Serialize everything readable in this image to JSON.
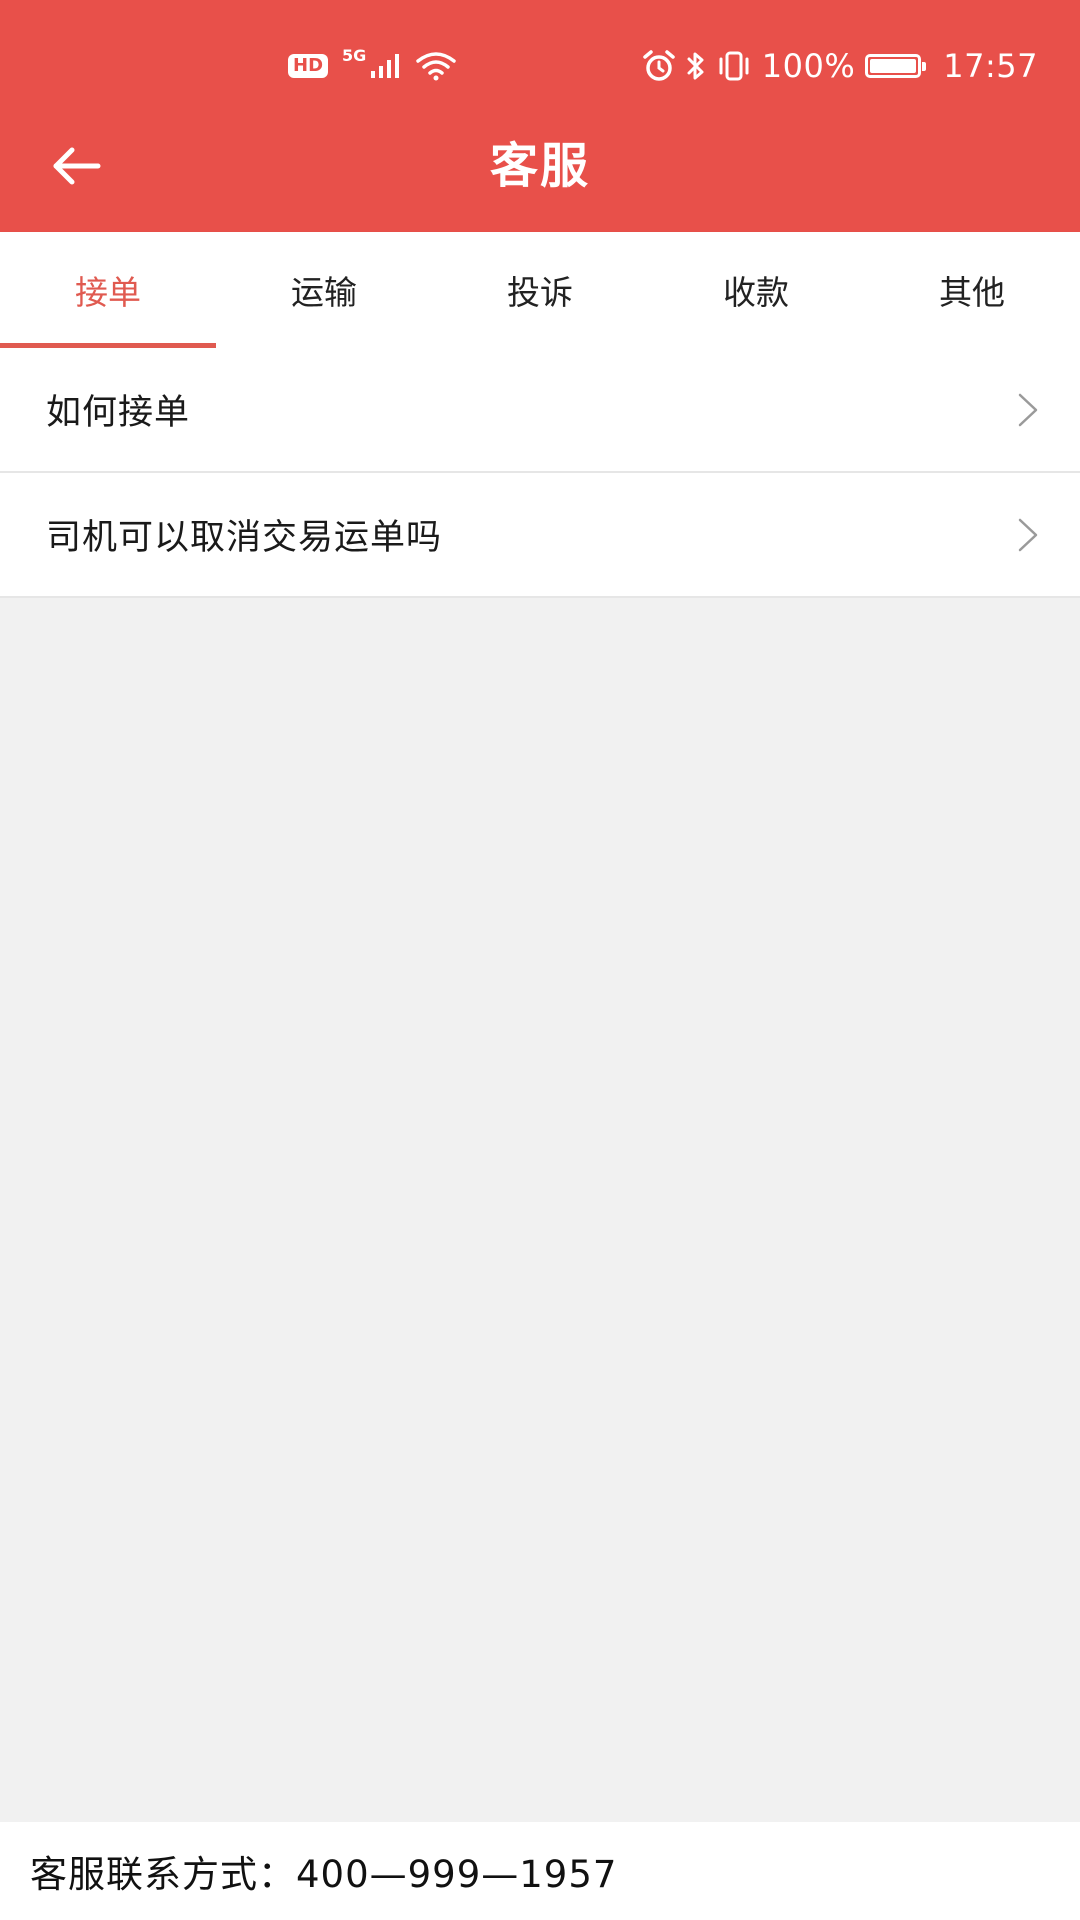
{
  "status_bar": {
    "hd_badge": "HD",
    "network_label": "5G",
    "battery_text": "100%",
    "time": "17:57",
    "battery_level": 1.0
  },
  "header": {
    "title": "客服",
    "back_icon": "arrow-left-icon",
    "background_color": "#e8504a"
  },
  "tabs": [
    {
      "label": "接单",
      "active": true
    },
    {
      "label": "运输",
      "active": false
    },
    {
      "label": "投诉",
      "active": false
    },
    {
      "label": "收款",
      "active": false
    },
    {
      "label": "其他",
      "active": false
    }
  ],
  "questions": [
    {
      "label": "如何接单"
    },
    {
      "label": "司机可以取消交易运单吗"
    }
  ],
  "footer": {
    "contact_text": "客服联系方式：400—999—1957"
  },
  "colors": {
    "accent": "#e05a50",
    "background": "#f1f1f1"
  }
}
